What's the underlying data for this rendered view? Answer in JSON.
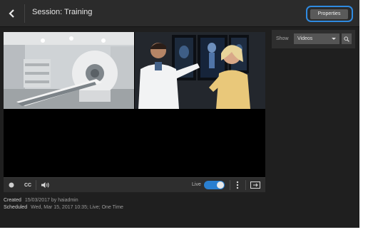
{
  "header": {
    "back_icon": "chevron-left-icon",
    "title": "Session: Training",
    "properties_label": "Properties"
  },
  "panel": {
    "show_label": "Show",
    "show_selected": "Videos",
    "search_icon": "search-icon"
  },
  "player": {
    "cc_label": "CC",
    "live_label": "Live",
    "live_on": true
  },
  "info": {
    "created_label": "Created",
    "created_value": "15/03/2017 by haiadmin",
    "scheduled_label": "Scheduled",
    "scheduled_value": "Wed, Mar 15, 2017 10:35; Live; One Time"
  },
  "colors": {
    "accent": "#2a7fd0",
    "highlight_ring": "#2f8ae0",
    "background": "#1f1f1f"
  }
}
